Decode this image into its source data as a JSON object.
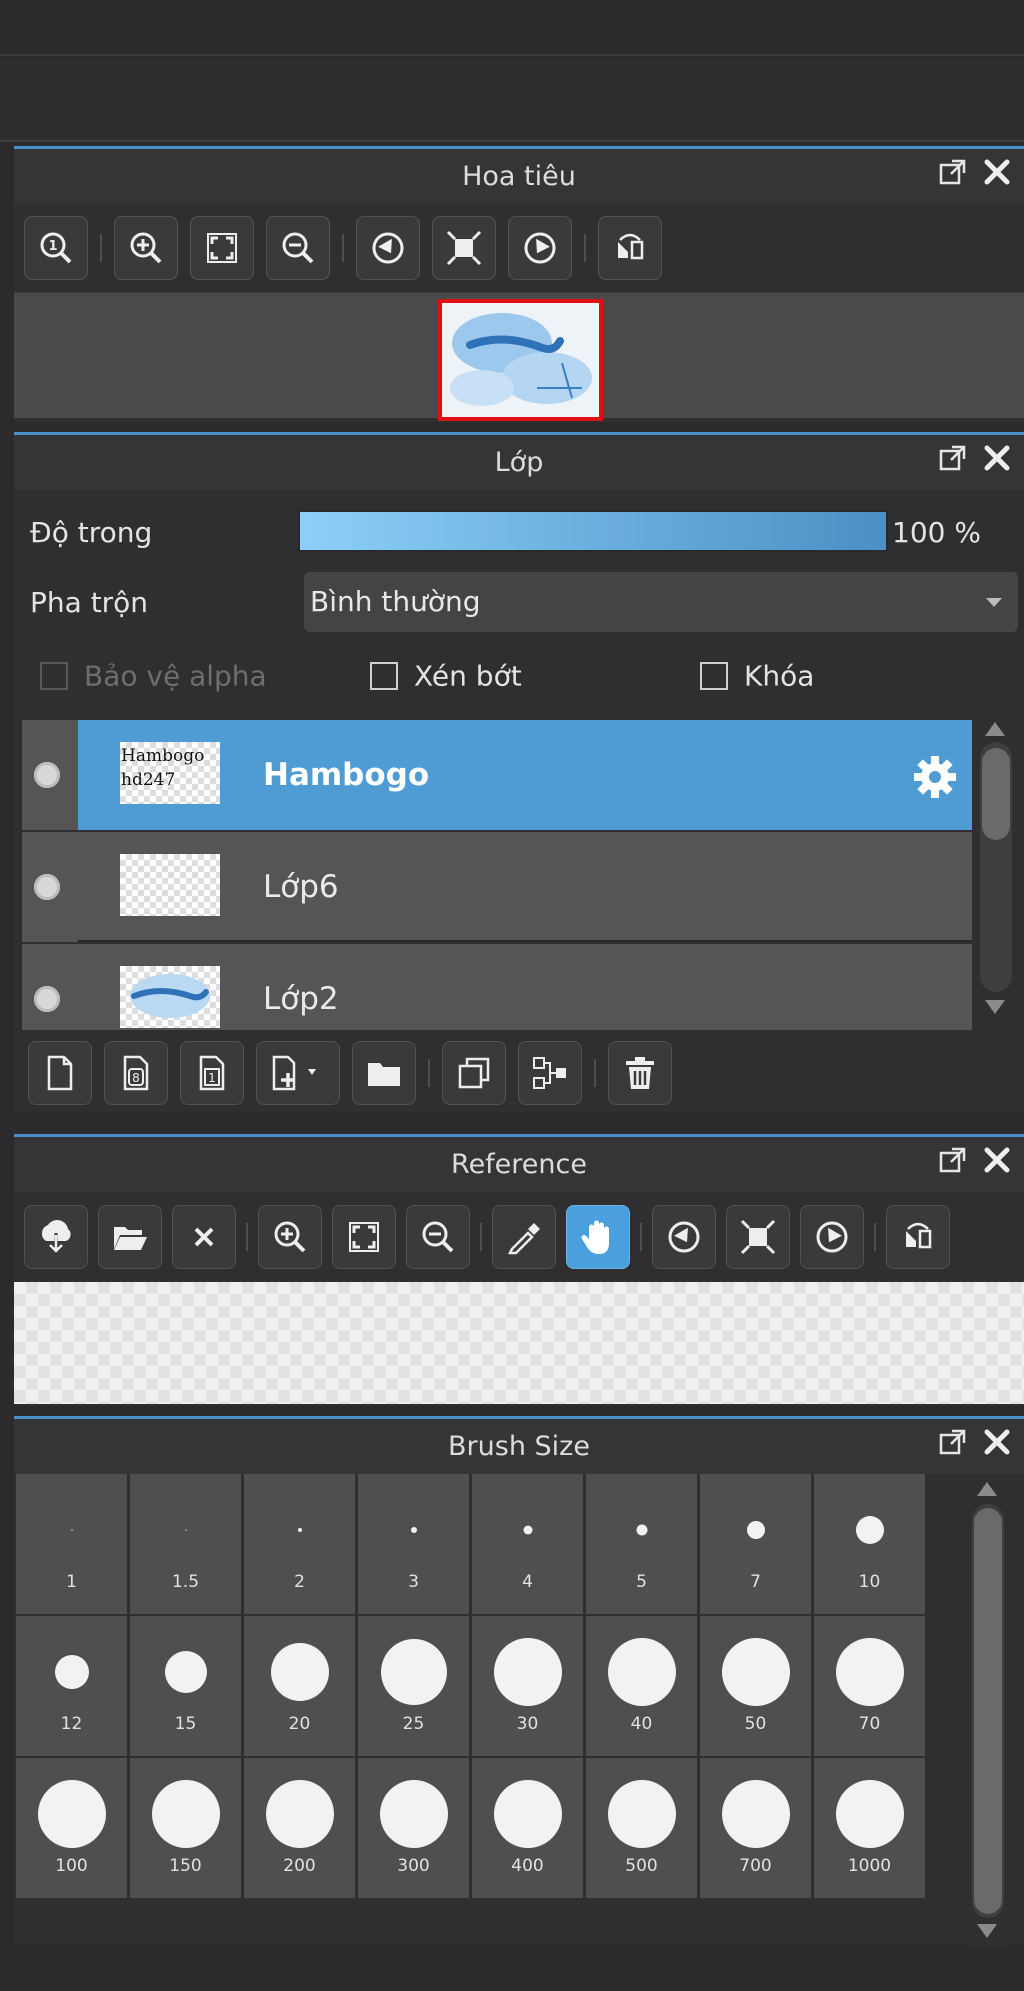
{
  "colors": {
    "accent": "#4f9bd3",
    "selection_outline": "#e01010",
    "panel_bg": "#2f2f31"
  },
  "navigator": {
    "title": "Hoa tiêu",
    "tools": [
      "zoom-actual-icon",
      "zoom-in-icon",
      "fit-screen-icon",
      "zoom-out-icon",
      "rotate-left-icon",
      "fit-canvas-icon",
      "rotate-right-icon",
      "flip-horizontal-icon"
    ]
  },
  "layer": {
    "title": "Lớp",
    "opacity_label": "Độ trong",
    "opacity_value": "100 %",
    "opacity_percent": 100,
    "blend_label": "Pha trộn",
    "blend_value": "Bình thường",
    "protect_alpha": "Bảo vệ alpha",
    "clipping": "Xén bớt",
    "lock": "Khóa",
    "layers": [
      {
        "name": "Hambogo",
        "thumb_text": "Hambogo\nhd247",
        "selected": true
      },
      {
        "name": "Lớp6",
        "thumb_text": "",
        "selected": false
      },
      {
        "name": "Lớp2",
        "thumb_text": "",
        "selected": false
      }
    ],
    "tools": [
      "new-layer-icon",
      "new-8bit-layer-icon",
      "new-1bit-layer-icon",
      "add-layer-menu-icon",
      "new-folder-icon",
      "duplicate-layer-icon",
      "merge-down-icon",
      "delete-layer-icon"
    ]
  },
  "reference": {
    "title": "Reference",
    "tools": [
      "import-icon",
      "open-folder-icon",
      "close-icon",
      "zoom-in-icon",
      "fit-screen-icon",
      "zoom-out-icon",
      "eyedropper-icon",
      "hand-icon",
      "rotate-left-icon",
      "fit-canvas-icon",
      "rotate-right-icon",
      "flip-horizontal-icon"
    ]
  },
  "brush_size": {
    "title": "Brush Size",
    "sizes": [
      "1",
      "1.5",
      "2",
      "3",
      "4",
      "5",
      "7",
      "10",
      "12",
      "15",
      "20",
      "25",
      "30",
      "40",
      "50",
      "70",
      "100",
      "150",
      "200",
      "300",
      "400",
      "500",
      "700",
      "1000"
    ]
  }
}
